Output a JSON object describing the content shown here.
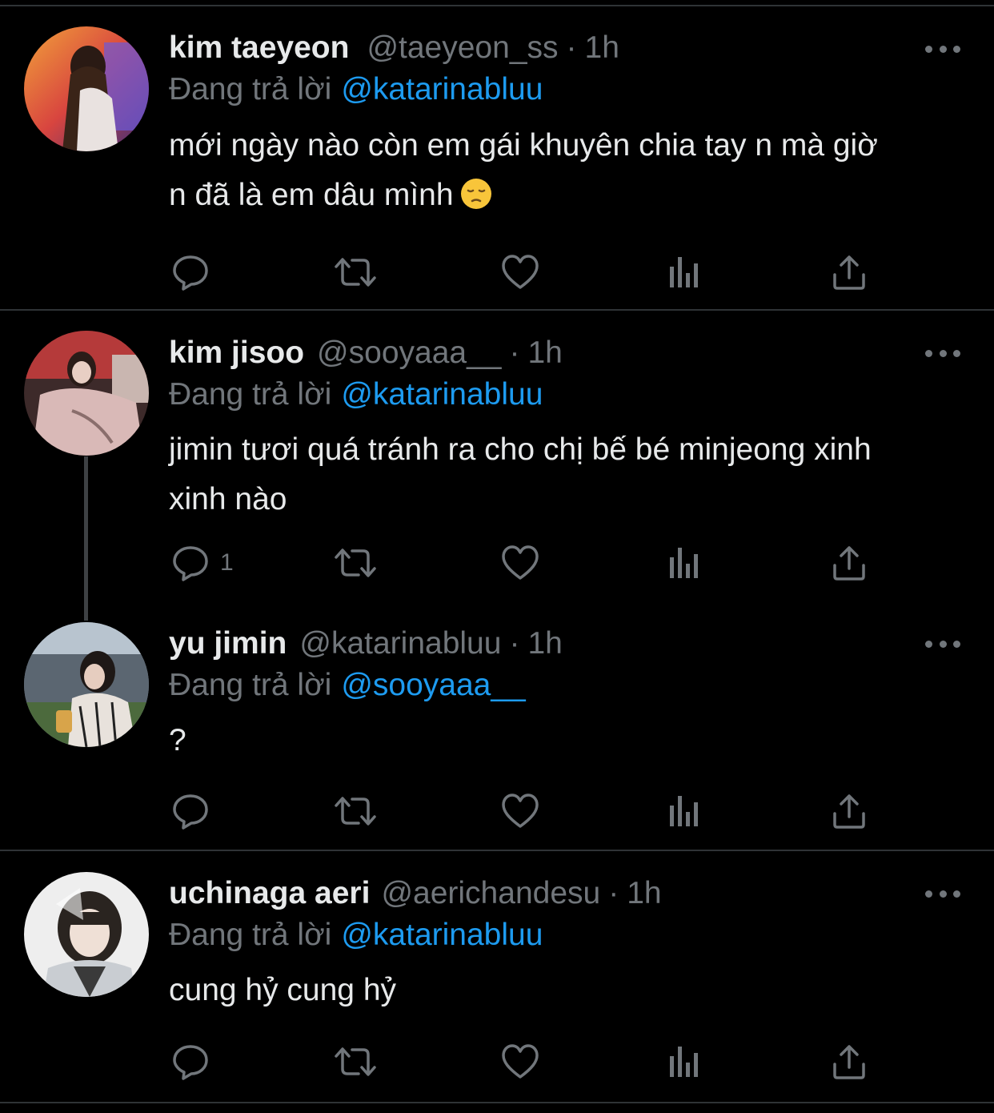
{
  "tweets": [
    {
      "name": "kim taeyeon",
      "handle": "@taeyeon_ss",
      "separator": "·",
      "time": "1h",
      "reply_prefix": "Đang trả lời",
      "reply_to": "@katarinabluu",
      "text_lines": [
        "mới ngày nào còn em gái khuyên chia tay n mà giờ",
        "n đã là em dâu mình"
      ],
      "emoji": "pensive-face",
      "reply_count": ""
    },
    {
      "name": "kim jisoo",
      "handle": "@sooyaaa__",
      "separator": "·",
      "time": "1h",
      "reply_prefix": "Đang trả lời",
      "reply_to": "@katarinabluu",
      "text_lines": [
        "jimin tươi quá tránh ra cho chị bế bé minjeong xinh",
        "xinh nào"
      ],
      "reply_count": "1"
    },
    {
      "name": "yu jimin",
      "handle": "@katarinabluu",
      "separator": "·",
      "time": "1h",
      "reply_prefix": "Đang trả lời",
      "reply_to": "@sooyaaa__",
      "text_lines": [
        "?"
      ],
      "reply_count": ""
    },
    {
      "name": "uchinaga aeri",
      "handle": "@aerichandesu",
      "separator": "·",
      "time": "1h",
      "reply_prefix": "Đang trả lời",
      "reply_to": "@katarinabluu",
      "text_lines": [
        "cung hỷ cung hỷ"
      ],
      "reply_count": ""
    }
  ],
  "icons": [
    "reply-icon",
    "retweet-icon",
    "like-icon",
    "views-icon",
    "share-icon",
    "more-icon"
  ],
  "colors": {
    "background": "#000000",
    "text": "#e7e9ea",
    "muted": "#71767b",
    "link": "#1d9bf0",
    "divider": "#2f3336"
  }
}
